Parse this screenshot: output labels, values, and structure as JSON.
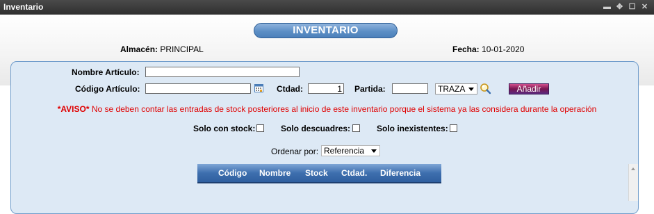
{
  "window": {
    "title": "Inventario",
    "controls": [
      "minimize-icon",
      "move-icon",
      "maximize-icon",
      "close-icon"
    ],
    "control_glyphs": [
      "▬",
      "✥",
      "☐",
      "✕"
    ]
  },
  "header": {
    "banner": "INVENTARIO",
    "almacen_label": "Almacén:",
    "almacen_value": "PRINCIPAL",
    "fecha_label": "Fecha:",
    "fecha_value": "10-01-2020"
  },
  "form": {
    "nombre_label": "Nombre Artículo:",
    "nombre_value": "",
    "codigo_label": "Código Artículo:",
    "codigo_value": "",
    "ctdad_label": "Ctdad:",
    "ctdad_value": "1",
    "partida_label": "Partida:",
    "partida_value": "",
    "traza_select": "TRAZA",
    "add_button": "Añadir"
  },
  "warning": {
    "prefix": "*AVISO*",
    "text": " No se deben contar las entradas de stock posteriores al inicio de este inventario porque el sistema ya las considera durante la operación"
  },
  "filters": {
    "solo_stock": "Solo con stock:",
    "solo_descuadres": "Solo descuadres:",
    "solo_inexistentes": "Solo inexistentes:"
  },
  "order": {
    "label": "Ordenar por:",
    "value": "Referencia"
  },
  "table": {
    "columns": [
      "Código",
      "Nombre",
      "Stock",
      "Ctdad.",
      "Diferencia"
    ]
  },
  "colors": {
    "titlebar": "#3a3a3a",
    "banner": "#5d8fc6",
    "panel_bg": "#dde9f5",
    "panel_border": "#6f9ccb",
    "warning": "#e00000",
    "add_button": "#7a1550",
    "table_header": "#3e6fae"
  }
}
